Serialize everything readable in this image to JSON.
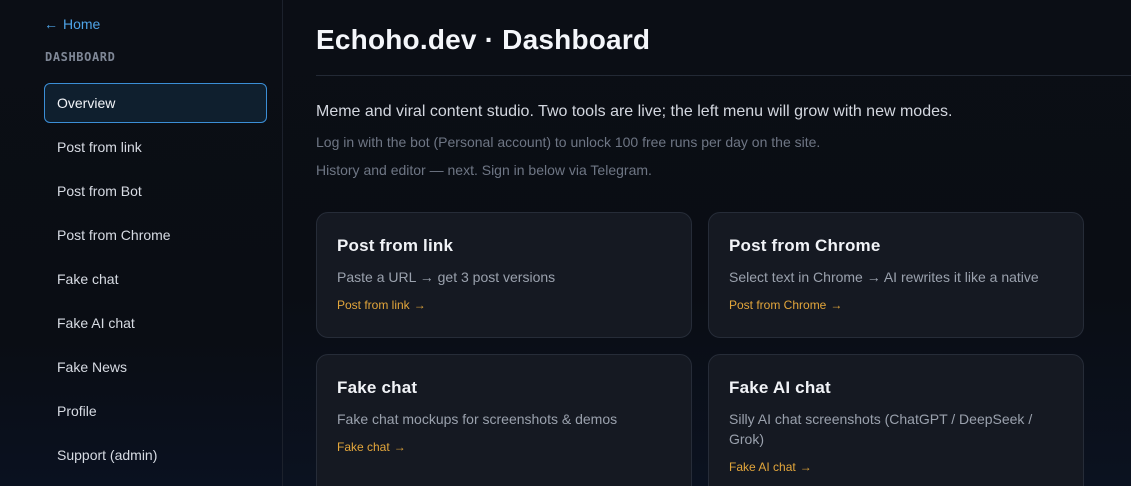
{
  "sidebar": {
    "home": {
      "arrow": "←",
      "label": "Home"
    },
    "section_label": "DASHBOARD",
    "items": [
      {
        "label": "Overview",
        "active": true
      },
      {
        "label": "Post from link"
      },
      {
        "label": "Post from Bot"
      },
      {
        "label": "Post from Chrome"
      },
      {
        "label": "Fake chat"
      },
      {
        "label": "Fake AI chat"
      },
      {
        "label": "Fake News"
      },
      {
        "label": "Profile"
      },
      {
        "label": "Support (admin)"
      }
    ]
  },
  "main": {
    "title": "Echoho.dev · Dashboard",
    "lead": "Meme and viral content studio. Two tools are live; the left menu will grow with new modes.",
    "sub1": "Log in with the bot (Personal account) to unlock 100 free runs per day on the site.",
    "sub2": "History and editor — next. Sign in below via Telegram.",
    "cards": [
      {
        "title": "Post from link",
        "desc": "Paste a URL → get 3 post versions",
        "link": "Post from link",
        "arrow": "→"
      },
      {
        "title": "Post from Chrome",
        "desc": "Select text in Chrome → AI rewrites it like a native",
        "link": "Post from Chrome",
        "arrow": "→"
      },
      {
        "title": "Fake chat",
        "desc": "Fake chat mockups for screenshots & demos",
        "link": "Fake chat",
        "arrow": "→"
      },
      {
        "title": "Fake AI chat",
        "desc": "Silly AI chat screenshots (ChatGPT / DeepSeek / Grok)",
        "link": "Fake AI chat",
        "arrow": "→"
      }
    ]
  },
  "colors": {
    "accent_blue": "#4ea3e6",
    "active_border": "#3b8ed6",
    "link_orange": "#e3a63b",
    "background": "#0a0d14",
    "card_bg": "#151922"
  },
  "icons": {
    "home_arrow": "left-arrow-icon",
    "card_arrow": "right-arrow-icon"
  }
}
